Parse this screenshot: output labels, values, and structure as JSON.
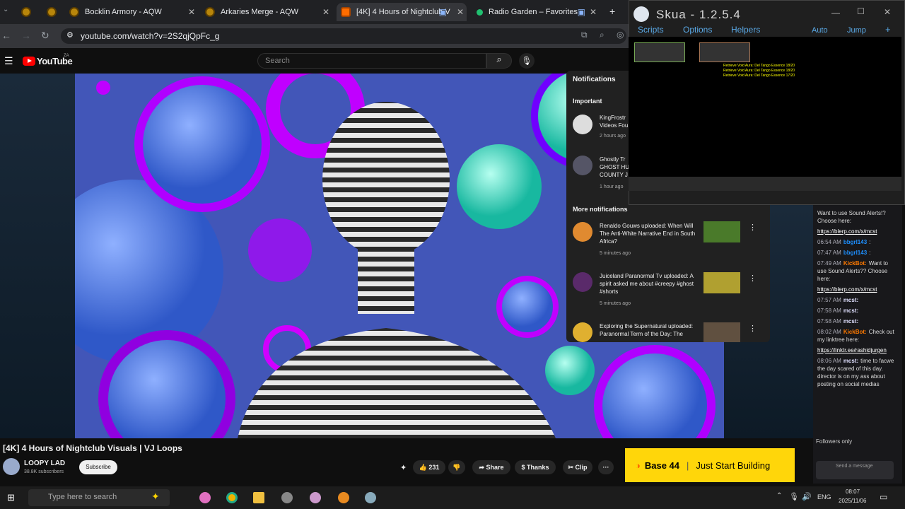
{
  "browser": {
    "tabs": [
      {
        "label": "Bocklin Armory - AQW",
        "close": "✕"
      },
      {
        "label": "Arkaries Merge - AQW",
        "close": "✕"
      },
      {
        "label": "[4K] 4 Hours of Nightclub V",
        "close": "✕"
      },
      {
        "label": "Radio Garden – Favorites",
        "close": "✕"
      }
    ],
    "new_tab": "+",
    "url": "youtube.com/watch?v=2S2qjQpFc_g"
  },
  "youtube": {
    "logo": "YouTube",
    "logo_suffix": "ZA",
    "search_placeholder": "Search"
  },
  "notifications": {
    "title": "Notifications",
    "important_header": "Important",
    "more_header": "More notifications",
    "important": [
      {
        "text": "KingFrostr\nVideos Fou",
        "time": "2 hours ago"
      },
      {
        "text": "Ghostly Tr\nGHOST HU\nCOUNTY J",
        "time": "1 hour ago"
      }
    ],
    "more": [
      {
        "text": "Renaldo Gouws uploaded: When Will The Anti-White Narrative End in South Africa?",
        "time": "5 minutes ago"
      },
      {
        "text": "Juiceland Paranormal Tv uploaded: A spirit asked me about #creepy #ghost #shorts",
        "time": "5 minutes ago"
      },
      {
        "text": "Exploring the Supernatural uploaded: Paranormal Term of the Day: The",
        "time": ""
      }
    ]
  },
  "skua": {
    "title": "Skua - 1.2.5.4",
    "menu": [
      "Scripts",
      "Options",
      "Helpers"
    ],
    "right_menu": [
      "Auto",
      "Jump",
      "+"
    ],
    "game_quest_lines": [
      "Retrieve Void Aura: Del Tango Essence 18/20",
      "Retrieve Void Aura: Del Tango Essence 18/20",
      "Retrieve Void Aura: Del Tango Essence 17/20"
    ]
  },
  "chat": {
    "lines": [
      {
        "time": "",
        "name": "",
        "text": "Want to use Sound Alerts!? Choose here:"
      },
      {
        "time": "",
        "name": "",
        "text": "https://blerp.com/x/mcst",
        "link": true
      },
      {
        "time": "06:54 AM",
        "name": "bbgrl143",
        "text": ":"
      },
      {
        "time": "07:47 AM",
        "name": "bbgrl143",
        "text": ":"
      },
      {
        "time": "07:49 AM",
        "name": "KickBot:",
        "text": "Want to use Sound Alerts?? Choose here:"
      },
      {
        "time": "",
        "name": "",
        "text": "https://blerp.com/x/mcst",
        "link": true
      },
      {
        "time": "07:57 AM",
        "name": "mcst:",
        "text": ""
      },
      {
        "time": "07:58 AM",
        "name": "mcst:",
        "text": ""
      },
      {
        "time": "07:58 AM",
        "name": "mcst:",
        "text": ""
      },
      {
        "time": "08:02 AM",
        "name": "KickBot:",
        "text": "Check out my linktree here:"
      },
      {
        "time": "",
        "name": "",
        "text": "https://linktr.ee/rashidjurgen",
        "link": true
      },
      {
        "time": "08:06 AM",
        "name": "mcst:",
        "text": "time to facwe the day scared of this day. director is on my ass about posting on social medias"
      }
    ],
    "followers_only": "Followers only",
    "send_placeholder": "Send a message"
  },
  "video": {
    "title": "[4K] 4 Hours of Nightclub Visuals | VJ Loops",
    "channel": "LOOPY LAD",
    "subscribers": "38.8K subscribers",
    "subscribe": "Subscribe",
    "likes": "231",
    "share": "Share",
    "thanks": "Thanks",
    "clip": "Clip",
    "more": "···"
  },
  "ad": {
    "brand": "Base 44",
    "tagline": "Just Start Building"
  },
  "taskbar": {
    "search_placeholder": "Type here to search",
    "lang": "ENG",
    "time": "08:07",
    "date": "2025/11/06"
  }
}
